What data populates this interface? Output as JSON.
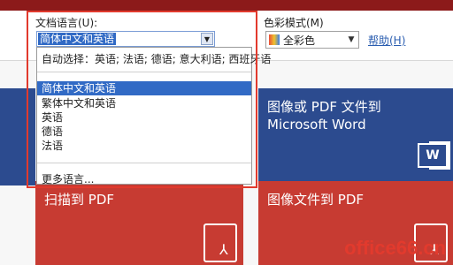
{
  "language": {
    "label": "文档语言(U):",
    "selected": "简体中文和英语",
    "auto_detect": "自动选择：英语; 法语; 德语; 意大利语; 西班牙语",
    "options": [
      "简体中文和英语",
      "繁体中文和英语",
      "英语",
      "德语",
      "法语"
    ],
    "more": "更多语言..."
  },
  "color_mode": {
    "label": "色彩模式(M)",
    "selected": "全彩色"
  },
  "help": {
    "label": "帮助(H)"
  },
  "tiles": {
    "image_to_word_line1": "图像或 PDF 文件到",
    "image_to_word_line2": "Microsoft Word",
    "scan_to_pdf": "扫描到 PDF",
    "image_to_pdf": "图像文件到 PDF",
    "word_icon_letter": "W"
  },
  "watermark": "office66.cn",
  "colors": {
    "accent_red": "#e23a2d",
    "tile_red": "#c73b32",
    "tile_blue": "#2c4b8f",
    "selection_blue": "#316ac5"
  }
}
